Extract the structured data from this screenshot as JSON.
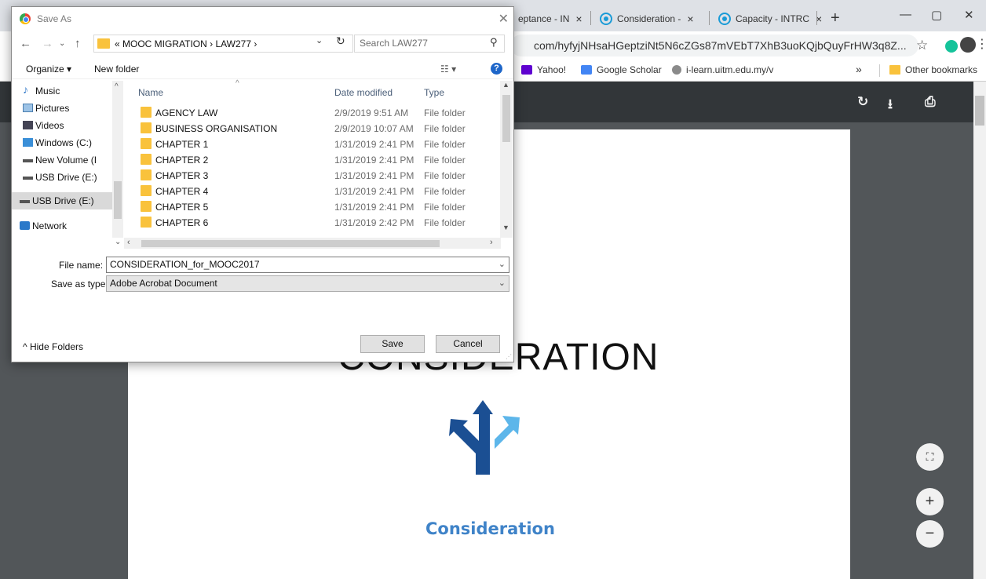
{
  "browser": {
    "tabs": [
      {
        "label": "eptance - IN",
        "close": "×"
      },
      {
        "label": "Consideration - ",
        "close": "×"
      },
      {
        "label": "Capacity - INTRC",
        "close": "×"
      }
    ],
    "new_tab": "+",
    "window_controls": {
      "minimize": "—",
      "maximize": "▢",
      "close": "✕"
    },
    "url": "com/hyfyjNHsaHGeptziNt5N6cZGs87mVEbT7XhB3uoKQjbQuyFrHW3q8Z...",
    "bookmarks": [
      {
        "label": "Yahoo!",
        "icon": "mail-icon"
      },
      {
        "label": "Google Scholar",
        "icon": "scholar-icon"
      },
      {
        "label": "i-learn.uitm.edu.my/v",
        "icon": "globe-icon"
      }
    ],
    "bookmarks_overflow": "»",
    "other_bookmarks": "Other bookmarks"
  },
  "pdf": {
    "title_text": "CONSIDERATION",
    "logo_text": "Consideration",
    "zoom_in": "+",
    "zoom_out": "−",
    "fit": "⛶"
  },
  "dialog": {
    "title": "Save As",
    "path": "«  MOOC MIGRATION  ›  LAW277  ›",
    "search_placeholder": "Search LAW277",
    "organize": "Organize ▾",
    "new_folder": "New folder",
    "nav_items": [
      {
        "label": "Music"
      },
      {
        "label": "Pictures"
      },
      {
        "label": "Videos"
      },
      {
        "label": "Windows (C:)"
      },
      {
        "label": "New Volume (I"
      },
      {
        "label": "USB Drive (E:)"
      },
      {
        "label": "USB Drive (E:)"
      },
      {
        "label": "Network"
      }
    ],
    "columns": {
      "name": "Name",
      "date": "Date modified",
      "type": "Type"
    },
    "files": [
      {
        "name": "AGENCY LAW",
        "date": "2/9/2019 9:51 AM",
        "type": "File folder"
      },
      {
        "name": "BUSINESS ORGANISATION",
        "date": "2/9/2019 10:07 AM",
        "type": "File folder"
      },
      {
        "name": "CHAPTER 1",
        "date": "1/31/2019 2:41 PM",
        "type": "File folder"
      },
      {
        "name": "CHAPTER 2",
        "date": "1/31/2019 2:41 PM",
        "type": "File folder"
      },
      {
        "name": "CHAPTER 3",
        "date": "1/31/2019 2:41 PM",
        "type": "File folder"
      },
      {
        "name": "CHAPTER 4",
        "date": "1/31/2019 2:41 PM",
        "type": "File folder"
      },
      {
        "name": "CHAPTER 5",
        "date": "1/31/2019 2:41 PM",
        "type": "File folder"
      },
      {
        "name": "CHAPTER 6",
        "date": "1/31/2019 2:42 PM",
        "type": "File folder"
      }
    ],
    "file_name_label": "File name:",
    "file_name_value": "CONSIDERATION_for_MOOC2017",
    "save_type_label": "Save as type:",
    "save_type_value": "Adobe Acrobat Document",
    "hide_folders": "Hide Folders",
    "save": "Save",
    "cancel": "Cancel"
  }
}
